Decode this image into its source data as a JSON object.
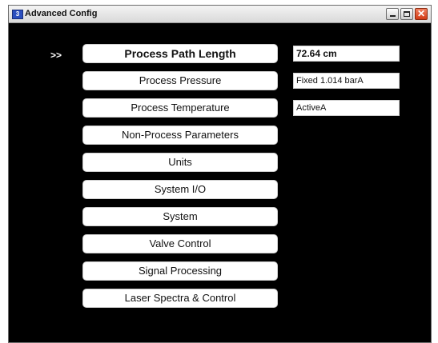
{
  "window": {
    "title": "Advanced Config",
    "icon": "app-window-icon",
    "controls": [
      "minimize",
      "maximize",
      "close"
    ]
  },
  "selection_marker": ">>",
  "menu": {
    "items": [
      {
        "label": "Process Path Length",
        "selected": true
      },
      {
        "label": "Process Pressure"
      },
      {
        "label": "Process Temperature"
      },
      {
        "label": "Non-Process Parameters"
      },
      {
        "label": "Units"
      },
      {
        "label": "System I/O"
      },
      {
        "label": "System"
      },
      {
        "label": "Valve Control"
      },
      {
        "label": "Signal Processing"
      },
      {
        "label": "Laser Spectra & Control"
      }
    ]
  },
  "values": {
    "path_length": "72.64 cm",
    "pressure": "Fixed 1.014 barA",
    "temperature": "ActiveA"
  },
  "colors": {
    "background": "#000000",
    "button": "#ffffff",
    "close_button": "#d23a14"
  }
}
